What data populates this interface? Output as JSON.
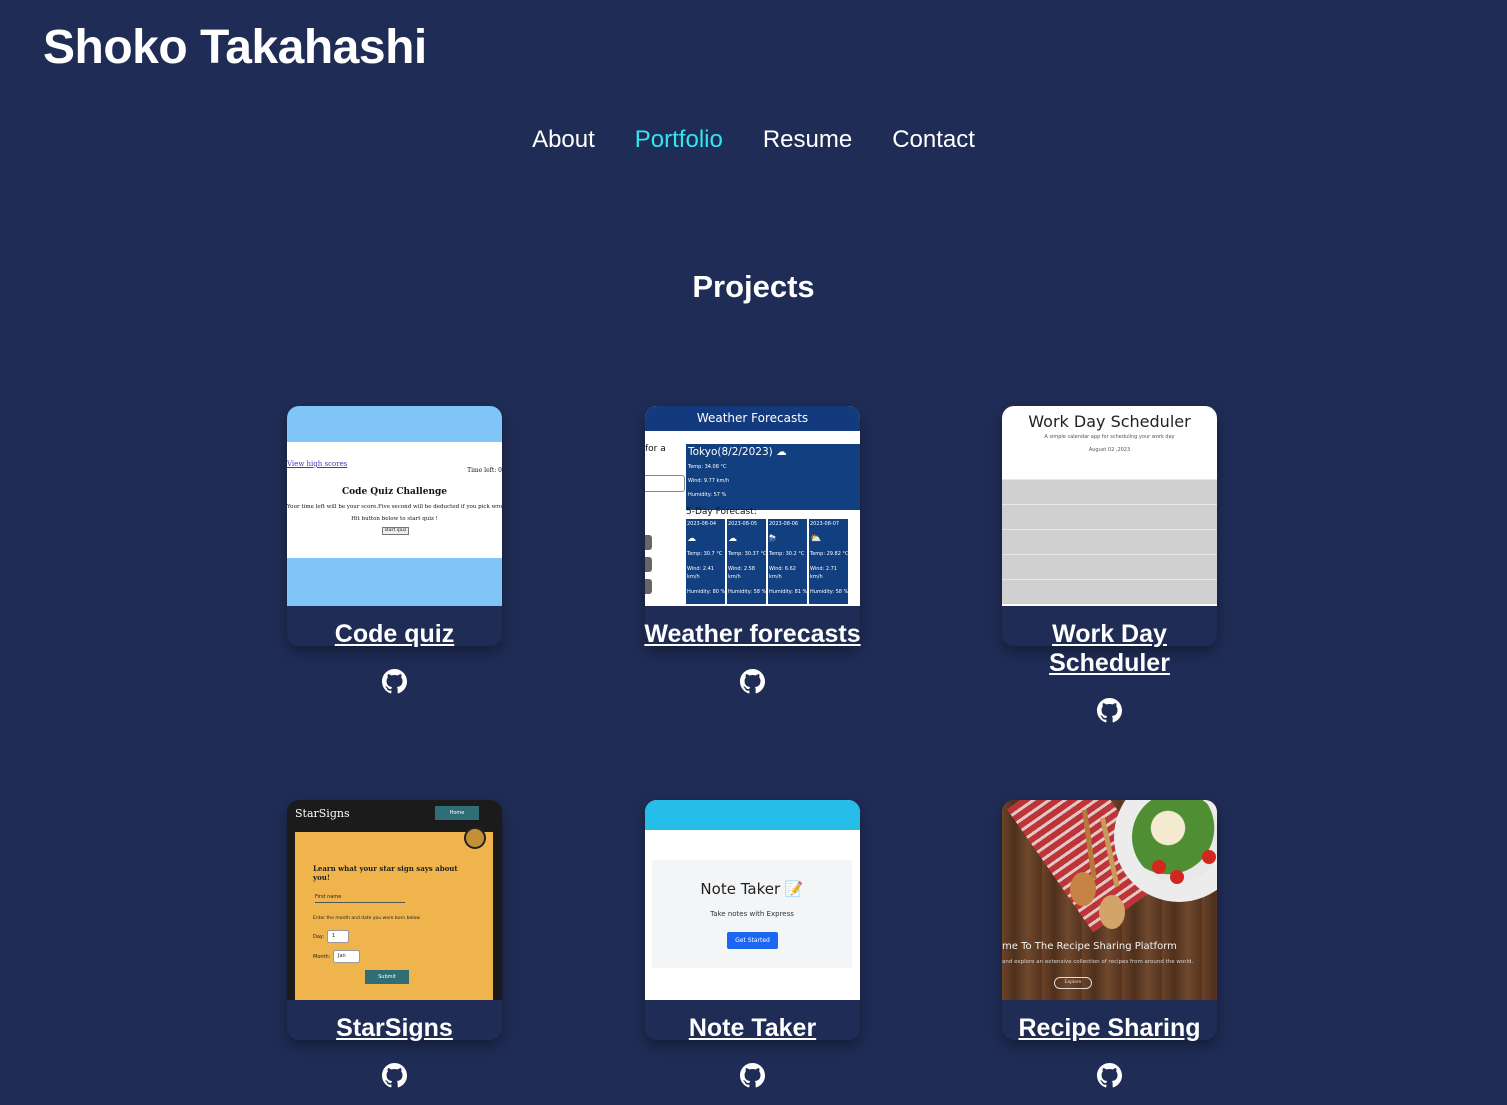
{
  "header": {
    "title": "Shoko Takahashi"
  },
  "nav": {
    "items": [
      {
        "label": "About"
      },
      {
        "label": "Portfolio"
      },
      {
        "label": "Resume"
      },
      {
        "label": "Contact"
      }
    ],
    "active": "Portfolio"
  },
  "section": {
    "title": "Projects"
  },
  "colors": {
    "background": "#1f2c55",
    "accent": "#34e5f0",
    "text": "#ffffff"
  },
  "projects": [
    {
      "title": "Code quiz",
      "repo_icon": "github-icon",
      "preview": {
        "link": "View high scores",
        "timer": "Time left: 0",
        "heading": "Code Quiz Challenge",
        "line1": "Your time left will be your score.Five second will be deducted if you pick wrong answer.",
        "line2": "Hit button below to start quiz !",
        "button": "start quiz"
      }
    },
    {
      "title": "Weather forecasts",
      "repo_icon": "github-icon",
      "preview": {
        "header": "Weather Forecasts",
        "search_label": "for a",
        "city": "Tokyo(8/2/2023) ☁",
        "temp": "Temp: 34.08 °C",
        "wind": "Wind: 9.77 km/h",
        "humidity": "Humidity: 57 %",
        "forecast_label": "5-Day Forecast:",
        "days": [
          {
            "date": "2023-08-04",
            "temp": "Temp: 30.7 °C",
            "wind": "Wind: 2.41",
            "unit": "km/h",
            "hum": "Humidity: 80 %"
          },
          {
            "date": "2023-08-05",
            "temp": "Temp: 30.37 °C",
            "wind": "Wind: 2.58",
            "unit": "km/h",
            "hum": "Humidity: 58 %"
          },
          {
            "date": "2023-08-06",
            "temp": "Temp: 30.2 °C",
            "wind": "Wind: 6.62",
            "unit": "km/h",
            "hum": "Humidity: 81 %"
          },
          {
            "date": "2023-08-07",
            "temp": "Temp: 29.82 °C",
            "wind": "Wind: 2.71",
            "unit": "km/h",
            "hum": "Humidity: 58 %"
          }
        ]
      }
    },
    {
      "title": "Work Day Scheduler",
      "repo_icon": "github-icon",
      "preview": {
        "heading": "Work Day Scheduler",
        "subtitle": "A simple calendar app for scheduling your work day",
        "date": "August 02 ,2023"
      }
    },
    {
      "title": "StarSigns",
      "repo_icon": "github-icon",
      "preview": {
        "brand": "StarSigns",
        "home": "Home",
        "question": "Learn what your star sign says about you!",
        "first_name": "First name",
        "instructions": "Enter the month and date you were born below",
        "day_label": "Day:",
        "day_value": "1",
        "month_label": "Month:",
        "month_value": "Jan",
        "submit": "Submit"
      }
    },
    {
      "title": "Note Taker",
      "repo_icon": "github-icon",
      "preview": {
        "heading": "Note Taker 📝",
        "subtitle": "Take notes with Express",
        "button": "Get Started"
      }
    },
    {
      "title": "Recipe Sharing",
      "repo_icon": "github-icon",
      "preview": {
        "heading": "me To The Recipe Sharing Platform",
        "subtitle": "and explore an extensive collection of recipes from around the world.",
        "button": "Explore"
      }
    }
  ]
}
